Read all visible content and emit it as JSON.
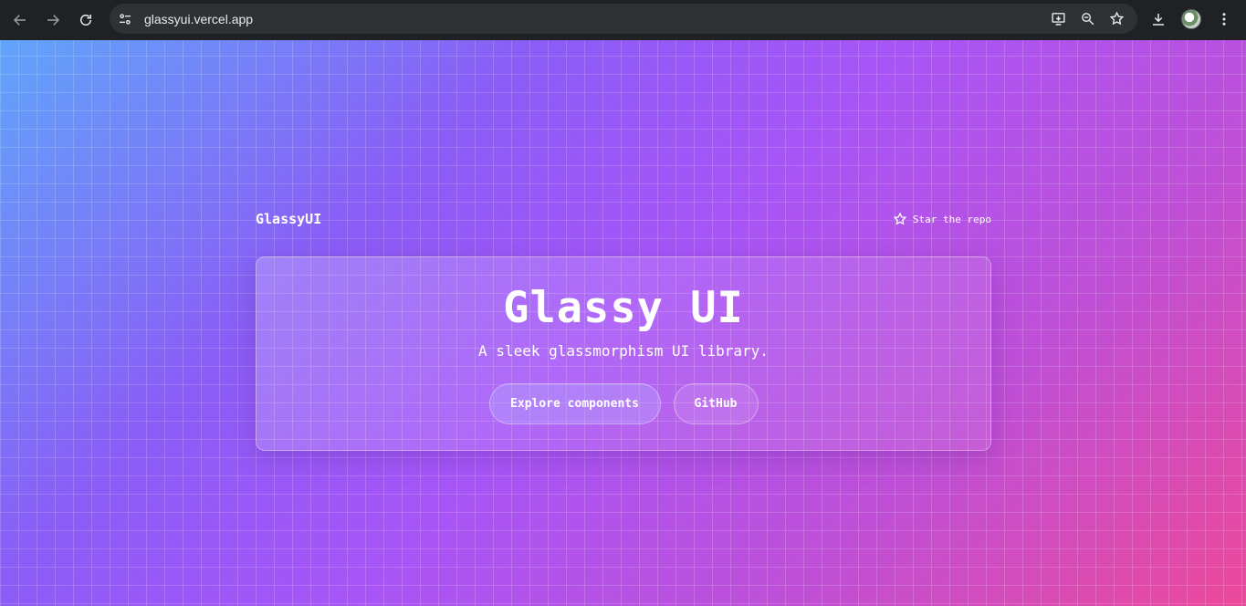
{
  "browser": {
    "url": "glassyui.vercel.app",
    "icons": {
      "back": "arrow-left-icon",
      "forward": "arrow-right-icon",
      "reload": "reload-icon",
      "site_info": "tune-icon",
      "install": "install-app-icon",
      "zoom": "zoom-icon",
      "bookmark": "star-icon",
      "download": "download-icon",
      "profile": "avatar",
      "menu": "kebab-menu-icon"
    }
  },
  "page": {
    "brand": "GlassyUI",
    "star_link": "Star the repo",
    "hero": {
      "title": "Glassy UI",
      "subtitle": "A sleek glassmorphism UI library.",
      "primary_button": "Explore components",
      "secondary_button": "GitHub"
    },
    "colors": {
      "gradient_start": "#60a5fa",
      "gradient_mid": "#a855f7",
      "gradient_end": "#ec4899",
      "text": "#ffffff"
    }
  }
}
